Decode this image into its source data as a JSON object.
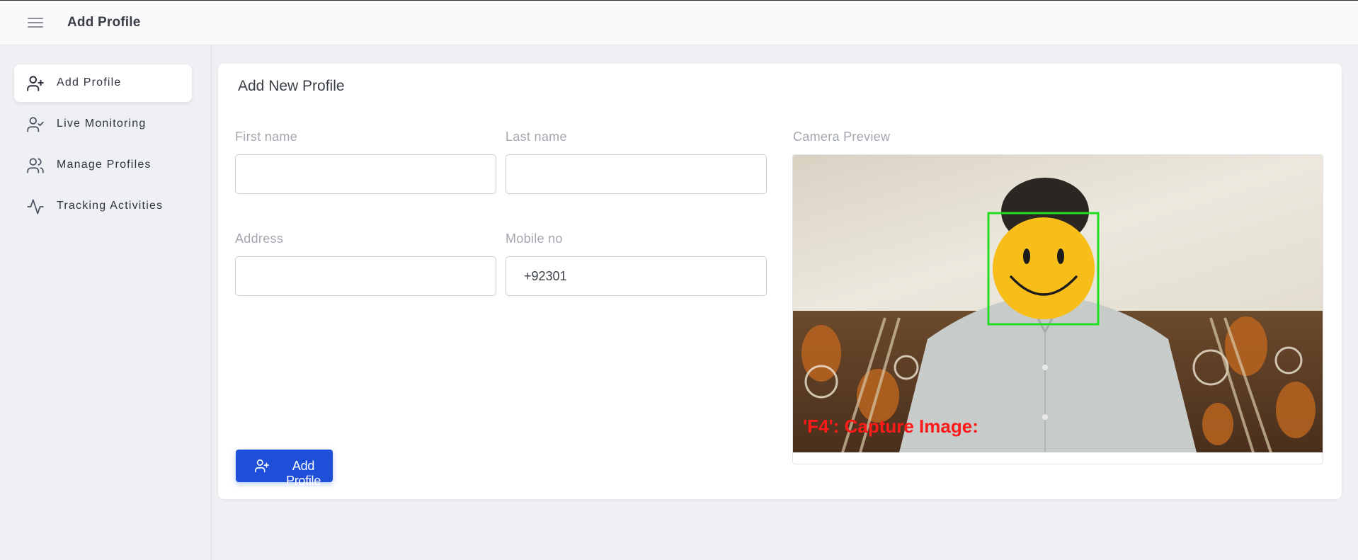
{
  "header": {
    "title": "Add Profile",
    "menu_icon": "hamburger-menu-icon"
  },
  "sidebar": {
    "items": [
      {
        "label": "Add Profile",
        "icon": "user-plus-icon",
        "active": true
      },
      {
        "label": "Live Monitoring",
        "icon": "user-check-icon",
        "active": false
      },
      {
        "label": "Manage Profiles",
        "icon": "users-icon",
        "active": false
      },
      {
        "label": "Tracking Activities",
        "icon": "activity-icon",
        "active": false
      }
    ]
  },
  "form": {
    "title": "Add New Profile",
    "first_name": {
      "label": "First name",
      "value": ""
    },
    "last_name": {
      "label": "Last name",
      "value": ""
    },
    "address": {
      "label": "Address",
      "value": ""
    },
    "mobile": {
      "label": "Mobile no",
      "value": "+92301"
    },
    "camera": {
      "label": "Camera Preview",
      "overlay_text": "'F4': Capture Image:"
    },
    "submit": {
      "label": "Add Profile",
      "icon": "user-plus-icon"
    }
  },
  "colors": {
    "primary": "#1d4fd8",
    "face_box": "#22dd22",
    "overlay_text": "#ff1a1a",
    "emoji": "#f7bd19"
  }
}
